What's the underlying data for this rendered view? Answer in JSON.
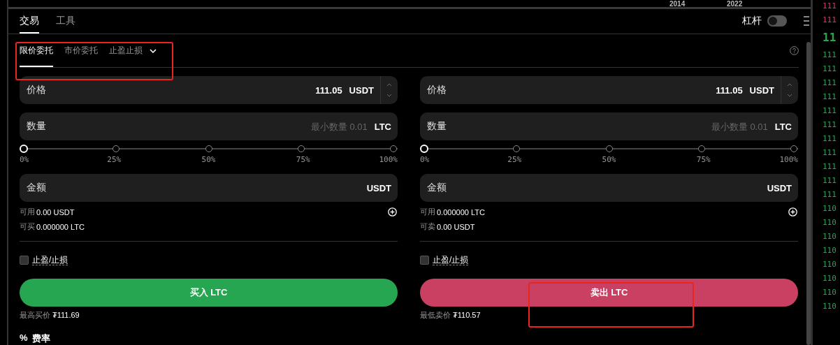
{
  "chart_axis": {
    "labels": [
      "2014",
      "2022"
    ]
  },
  "tabs": [
    {
      "label": "交易",
      "selected": true
    },
    {
      "label": "工具",
      "selected": false
    }
  ],
  "leverage": {
    "label": "杠杆",
    "on": false
  },
  "order_types": [
    {
      "label": "限价委托",
      "selected": true,
      "kind": "tab"
    },
    {
      "label": "市价委托",
      "selected": false,
      "kind": "tab"
    },
    {
      "label": "止盈止损",
      "selected": false,
      "kind": "dropdown"
    }
  ],
  "panels": [
    {
      "color": "#26a650",
      "price": {
        "label": "价格",
        "value": "111.05",
        "unit": "USDT"
      },
      "quantity": {
        "label": "数量",
        "placeholder": "最小数量 0.01",
        "unit": "LTC"
      },
      "slider": {
        "level": 0,
        "ticks": [
          "0%",
          "25%",
          "50%",
          "75%",
          "100%"
        ]
      },
      "amount": {
        "label": "金额",
        "unit": "USDT"
      },
      "balances": [
        {
          "label": "可用",
          "value": "0.00 USDT"
        },
        {
          "label": "可买",
          "value": "0.000000 LTC"
        }
      ],
      "tpsl": {
        "label": "止盈/止损",
        "checked": false
      },
      "button": "买入 LTC",
      "best_price": {
        "label": "最高买价",
        "value": "₮111.69"
      }
    },
    {
      "color": "#c94062",
      "price": {
        "label": "价格",
        "value": "111.05",
        "unit": "USDT"
      },
      "quantity": {
        "label": "数量",
        "placeholder": "最小数量 0.01",
        "unit": "LTC"
      },
      "slider": {
        "level": 0,
        "ticks": [
          "0%",
          "25%",
          "50%",
          "75%",
          "100%"
        ]
      },
      "amount": {
        "label": "金额",
        "unit": "USDT"
      },
      "balances": [
        {
          "label": "可用",
          "value": "0.000000 LTC"
        },
        {
          "label": "可卖",
          "value": "0.00 USDT"
        }
      ],
      "tpsl": {
        "label": "止盈/止损",
        "checked": false
      },
      "button": "卖出 LTC",
      "best_price": {
        "label": "最低卖价",
        "value": "₮110.57"
      }
    }
  ],
  "fee": {
    "icon": "%",
    "label": "费率"
  },
  "order_book": [
    {
      "price": "111",
      "kind": "ask"
    },
    {
      "price": "111",
      "kind": "ask"
    },
    {
      "price": "11",
      "kind": "last"
    },
    {
      "price": "111",
      "kind": "bid"
    },
    {
      "price": "111",
      "kind": "bid"
    },
    {
      "price": "111",
      "kind": "bid"
    },
    {
      "price": "111",
      "kind": "bid"
    },
    {
      "price": "111",
      "kind": "bid"
    },
    {
      "price": "111",
      "kind": "bid"
    },
    {
      "price": "111",
      "kind": "bid"
    },
    {
      "price": "111",
      "kind": "bid"
    },
    {
      "price": "111",
      "kind": "bid"
    },
    {
      "price": "111",
      "kind": "bid"
    },
    {
      "price": "111",
      "kind": "bid"
    },
    {
      "price": "110",
      "kind": "bid"
    },
    {
      "price": "110",
      "kind": "bid"
    },
    {
      "price": "110",
      "kind": "bid"
    },
    {
      "price": "110",
      "kind": "bid"
    },
    {
      "price": "110",
      "kind": "bid"
    },
    {
      "price": "110",
      "kind": "bid"
    },
    {
      "price": "110",
      "kind": "bid"
    },
    {
      "price": "110",
      "kind": "bid"
    }
  ]
}
